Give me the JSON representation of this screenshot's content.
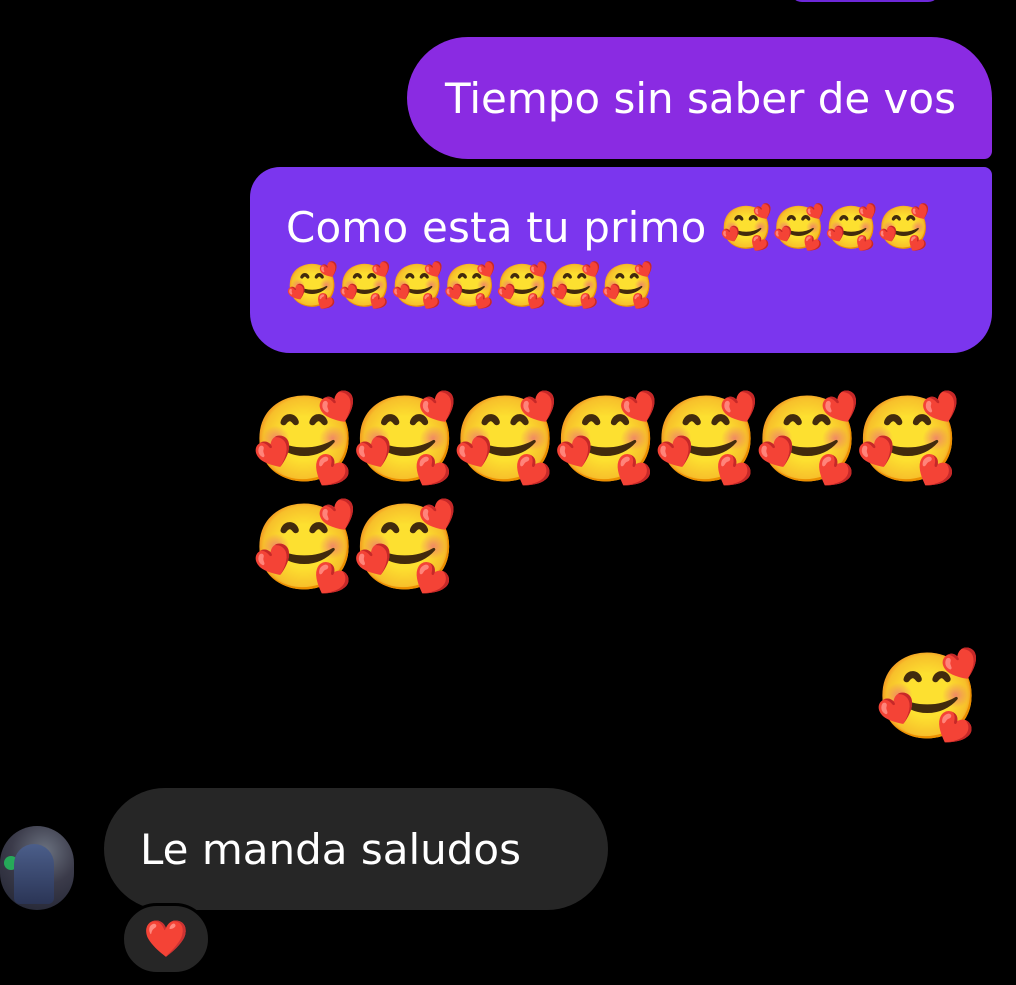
{
  "messages": {
    "outgoing_1": "Tiempo sin saber de vos",
    "outgoing_2": "Como esta tu primo 🥰🥰🥰🥰🥰🥰🥰🥰🥰🥰🥰",
    "outgoing_3": "🥰🥰🥰🥰🥰🥰🥰🥰🥰",
    "outgoing_4": "🥰",
    "incoming_1": "Le manda saludos"
  },
  "reaction": {
    "emoji": "❤️"
  },
  "colors": {
    "background": "#000000",
    "outgoing_bubble_top": "#8a2be2",
    "outgoing_bubble_bottom": "#7b36ee",
    "incoming_bubble": "#262626",
    "text": "#ffffff"
  },
  "icons": {
    "avatar": "user-avatar-photo",
    "reaction": "heart-icon"
  }
}
